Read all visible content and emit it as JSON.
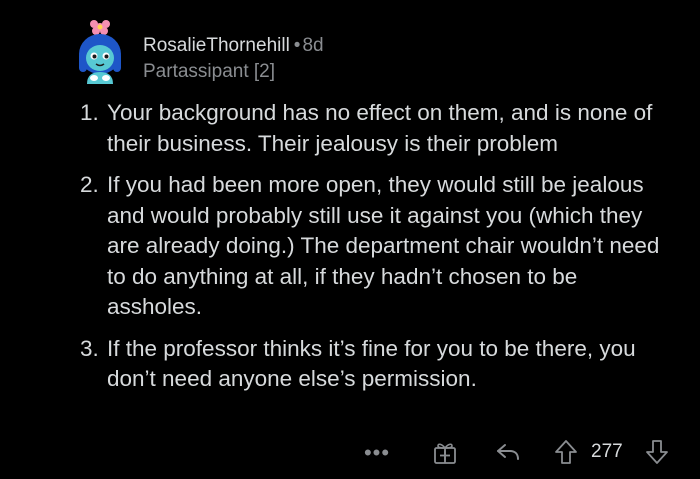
{
  "comment": {
    "author": "RosalieThornehill",
    "separator": "•",
    "age": "8d",
    "flair": "Partassipant [2]",
    "points": [
      {
        "number": "1.",
        "text": "Your background has no effect on them, and is none of their business. Their jealousy is their problem"
      },
      {
        "number": "2.",
        "text": "If you had been more open, they would still be jealous and would probably still use it against you (which they are already doing.) The department chair wouldn’t need to do anything at all, if they hadn’t chosen to be assholes."
      },
      {
        "number": "3.",
        "text": "If the professor thinks it’s fine for you to be there, you don’t need anyone else’s permission."
      }
    ]
  },
  "actions": {
    "more_label": "•••",
    "score": "277"
  },
  "icons": {
    "avatar": "avatar-icon",
    "more": "more-icon",
    "award": "award-icon",
    "reply": "reply-icon",
    "upvote": "upvote-icon",
    "downvote": "downvote-icon"
  },
  "colors": {
    "background": "#000000",
    "text": "#d7dadc",
    "meta": "#8a8d91"
  }
}
